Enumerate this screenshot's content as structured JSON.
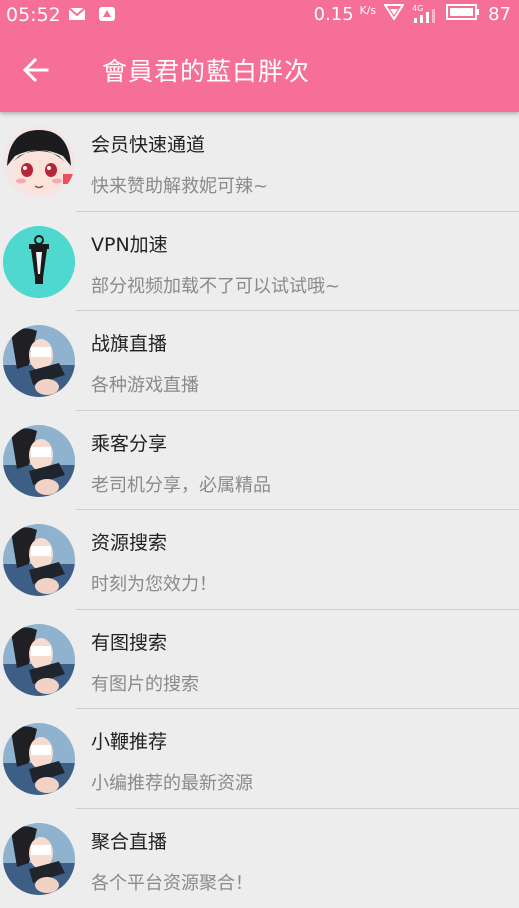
{
  "status_bar": {
    "time": "05:52",
    "speed": "0.15",
    "speed_unit": "K/s",
    "network": "4G",
    "battery": "87"
  },
  "toolbar": {
    "title": "會員君的藍白胖次"
  },
  "items": [
    {
      "title": "会员快速通道",
      "subtitle": "快来赞助解救妮可辣~",
      "avatar": "anime-girl-face"
    },
    {
      "title": "VPN加速",
      "subtitle": "部分视频加载不了可以试试哦~",
      "avatar": "lantern-icon"
    },
    {
      "title": "战旗直播",
      "subtitle": "各种游戏直播",
      "avatar": "anime-girl-figure"
    },
    {
      "title": "乘客分享",
      "subtitle": "老司机分享，必属精品",
      "avatar": "anime-girl-figure"
    },
    {
      "title": "资源搜索",
      "subtitle": "时刻为您效力！",
      "avatar": "anime-girl-figure"
    },
    {
      "title": "有图搜索",
      "subtitle": "有图片的搜索",
      "avatar": "anime-girl-figure"
    },
    {
      "title": "小鞭推荐",
      "subtitle": "小编推荐的最新资源",
      "avatar": "anime-girl-figure"
    },
    {
      "title": "聚合直播",
      "subtitle": "各个平台资源聚合！",
      "avatar": "anime-girl-figure"
    }
  ],
  "colors": {
    "appbar": "#f56f98",
    "background": "#ededed",
    "avatar_vpn": "#4fd8d0"
  }
}
